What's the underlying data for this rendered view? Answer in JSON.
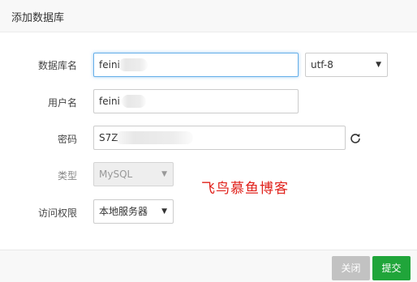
{
  "dialog": {
    "title": "添加数据库"
  },
  "form": {
    "db_name": {
      "label": "数据库名",
      "value": "feini"
    },
    "charset": {
      "value": "utf-8"
    },
    "username": {
      "label": "用户名",
      "value": "feini"
    },
    "password": {
      "label": "密码",
      "value": "S7Z"
    },
    "type": {
      "label": "类型",
      "value": "MySQL"
    },
    "access": {
      "label": "访问权限",
      "value": "本地服务器"
    }
  },
  "watermark": "飞鸟慕鱼博客",
  "footer": {
    "close_label": "关闭",
    "submit_label": "提交"
  },
  "colors": {
    "submit": "#20a53a",
    "close": "#c2c2c2",
    "focus_border": "#66afe9",
    "watermark": "#e0201a"
  }
}
